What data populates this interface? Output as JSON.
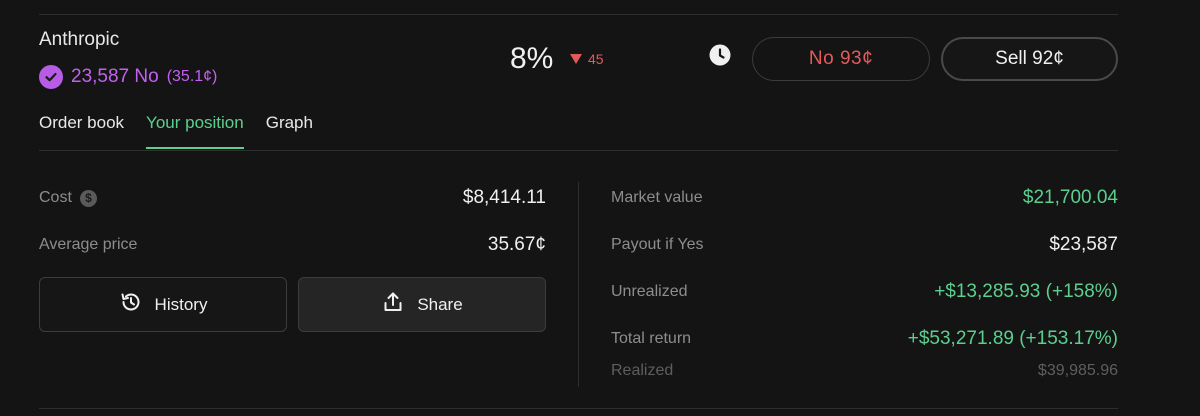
{
  "market": {
    "name": "Anthropic",
    "shares": "23,587 No",
    "avg_price": "(35.1¢)",
    "percent": "8%",
    "delta": "45"
  },
  "actions": {
    "no_label": "No",
    "no_price": "93¢",
    "sell_label": "Sell",
    "sell_price": "92¢"
  },
  "tabs": [
    {
      "label": "Order book",
      "active": false
    },
    {
      "label": "Your position",
      "active": true
    },
    {
      "label": "Graph",
      "active": false
    }
  ],
  "position": {
    "cost_label": "Cost",
    "cost_value": "$8,414.11",
    "avg_label": "Average price",
    "avg_value": "35.67¢",
    "history_label": "History",
    "share_label": "Share",
    "market_value_label": "Market value",
    "market_value": "$21,700.04",
    "payout_label": "Payout if Yes",
    "payout_value": "$23,587",
    "unrealized_label": "Unrealized",
    "unrealized_value": "+$13,285.93 (+158%)",
    "total_return_label": "Total return",
    "total_return_value": "+$53,271.89 (+153.17%)",
    "realized_label": "Realized",
    "realized_value": "$39,985.96"
  },
  "icons": {
    "verified": "check-circle-icon",
    "clock": "clock-icon",
    "cost_info": "dollar-circle-icon",
    "history": "history-icon",
    "share": "share-icon"
  },
  "colors": {
    "background": "#141414",
    "accent_green": "#5ccf8e",
    "accent_purple": "#c261f0",
    "negative_red": "#e05a5a"
  }
}
